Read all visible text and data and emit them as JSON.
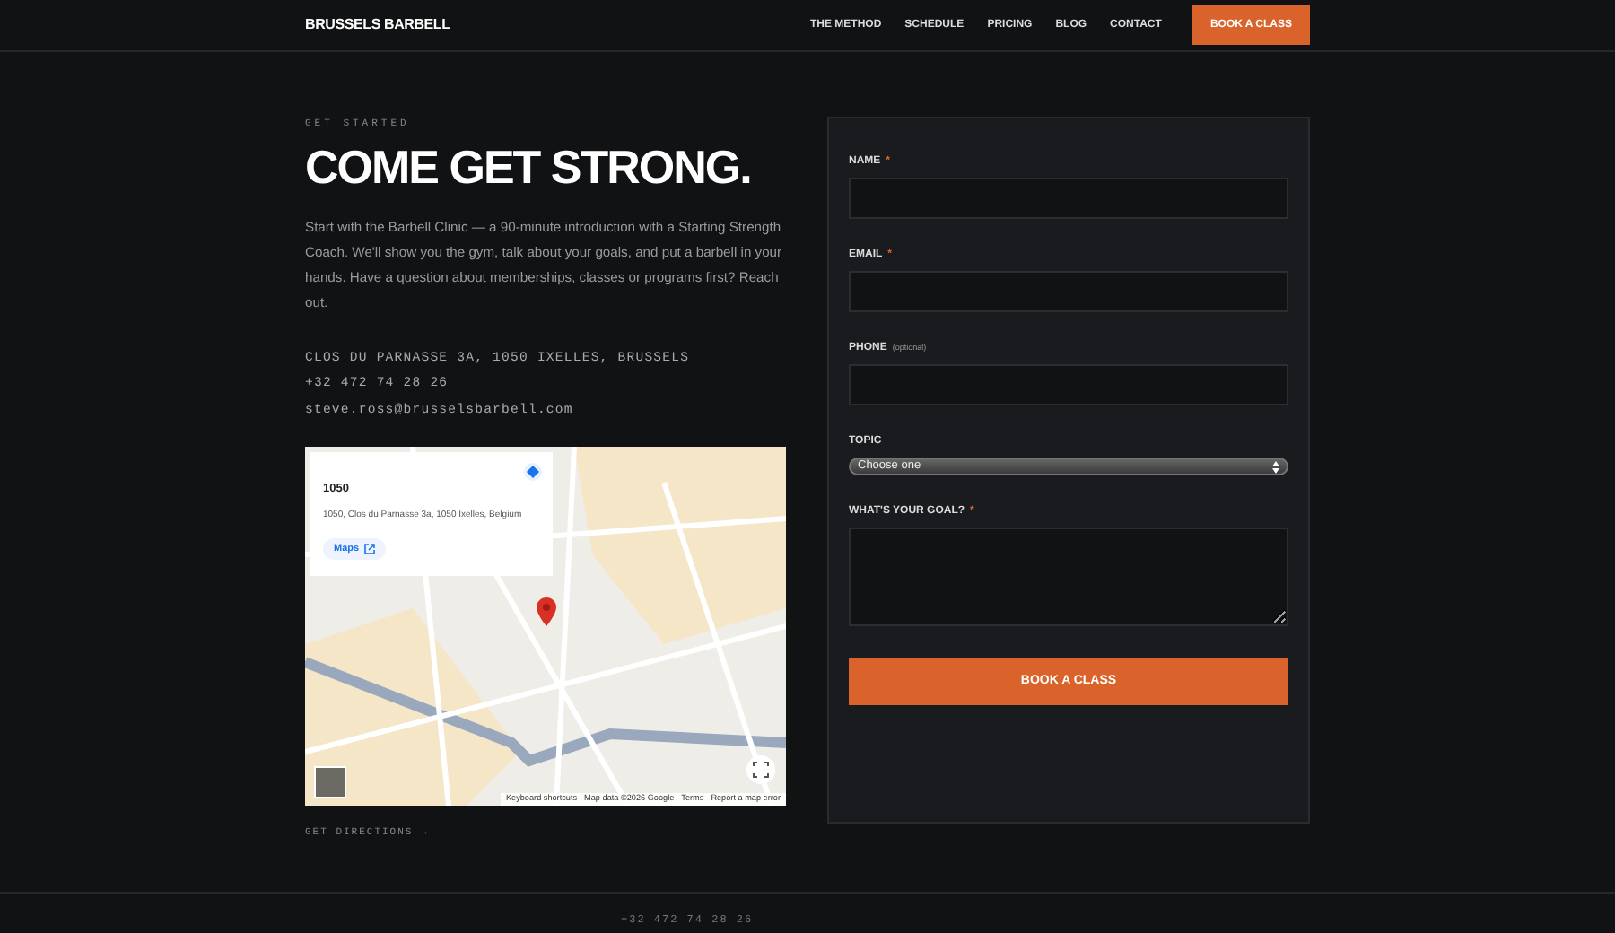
{
  "navbar": {
    "brand": "BRUSSELS BARBELL",
    "links": [
      "THE METHOD",
      "SCHEDULE",
      "PRICING",
      "BLOG",
      "CONTACT"
    ],
    "cta": "BOOK A CLASS"
  },
  "hero": {
    "eyebrow": "GET STARTED",
    "title": "COME GET STRONG.",
    "intro": "Start with the Barbell Clinic — a 90-minute introduction with a Starting Strength Coach. We'll show you the gym, talk about your goals, and put a barbell in your hands. Have a question about memberships, classes or programs first? Reach out.",
    "contacts": [
      "CLOS DU PARNASSE 3A, 1050 IXELLES, BRUSSELS",
      "+32 472 74 28 26",
      "steve.ross@brusselsbarbell.com"
    ]
  },
  "map": {
    "place_title": "1050",
    "place_address": "1050, Clos du Parnasse 3a, 1050 Ixelles, Belgium",
    "maps_link": "Maps",
    "attribution": [
      "Keyboard shortcuts",
      "Map data ©2026 Google",
      "Terms",
      "Report a map error"
    ],
    "directions": "GET DIRECTIONS →"
  },
  "form": {
    "fields": [
      {
        "kind": "text",
        "label": "NAME",
        "required_mark": "*"
      },
      {
        "kind": "text",
        "label": "EMAIL",
        "required_mark": "*"
      },
      {
        "kind": "text",
        "label": "PHONE",
        "hint": "(optional)"
      },
      {
        "kind": "select",
        "label": "TOPIC",
        "value": "Choose one"
      },
      {
        "kind": "textarea",
        "label": "WHAT'S YOUR GOAL?",
        "required_mark": "*"
      }
    ],
    "submit": "BOOK A CLASS"
  },
  "footer": {
    "phone": "+32 472 74 28 26"
  }
}
